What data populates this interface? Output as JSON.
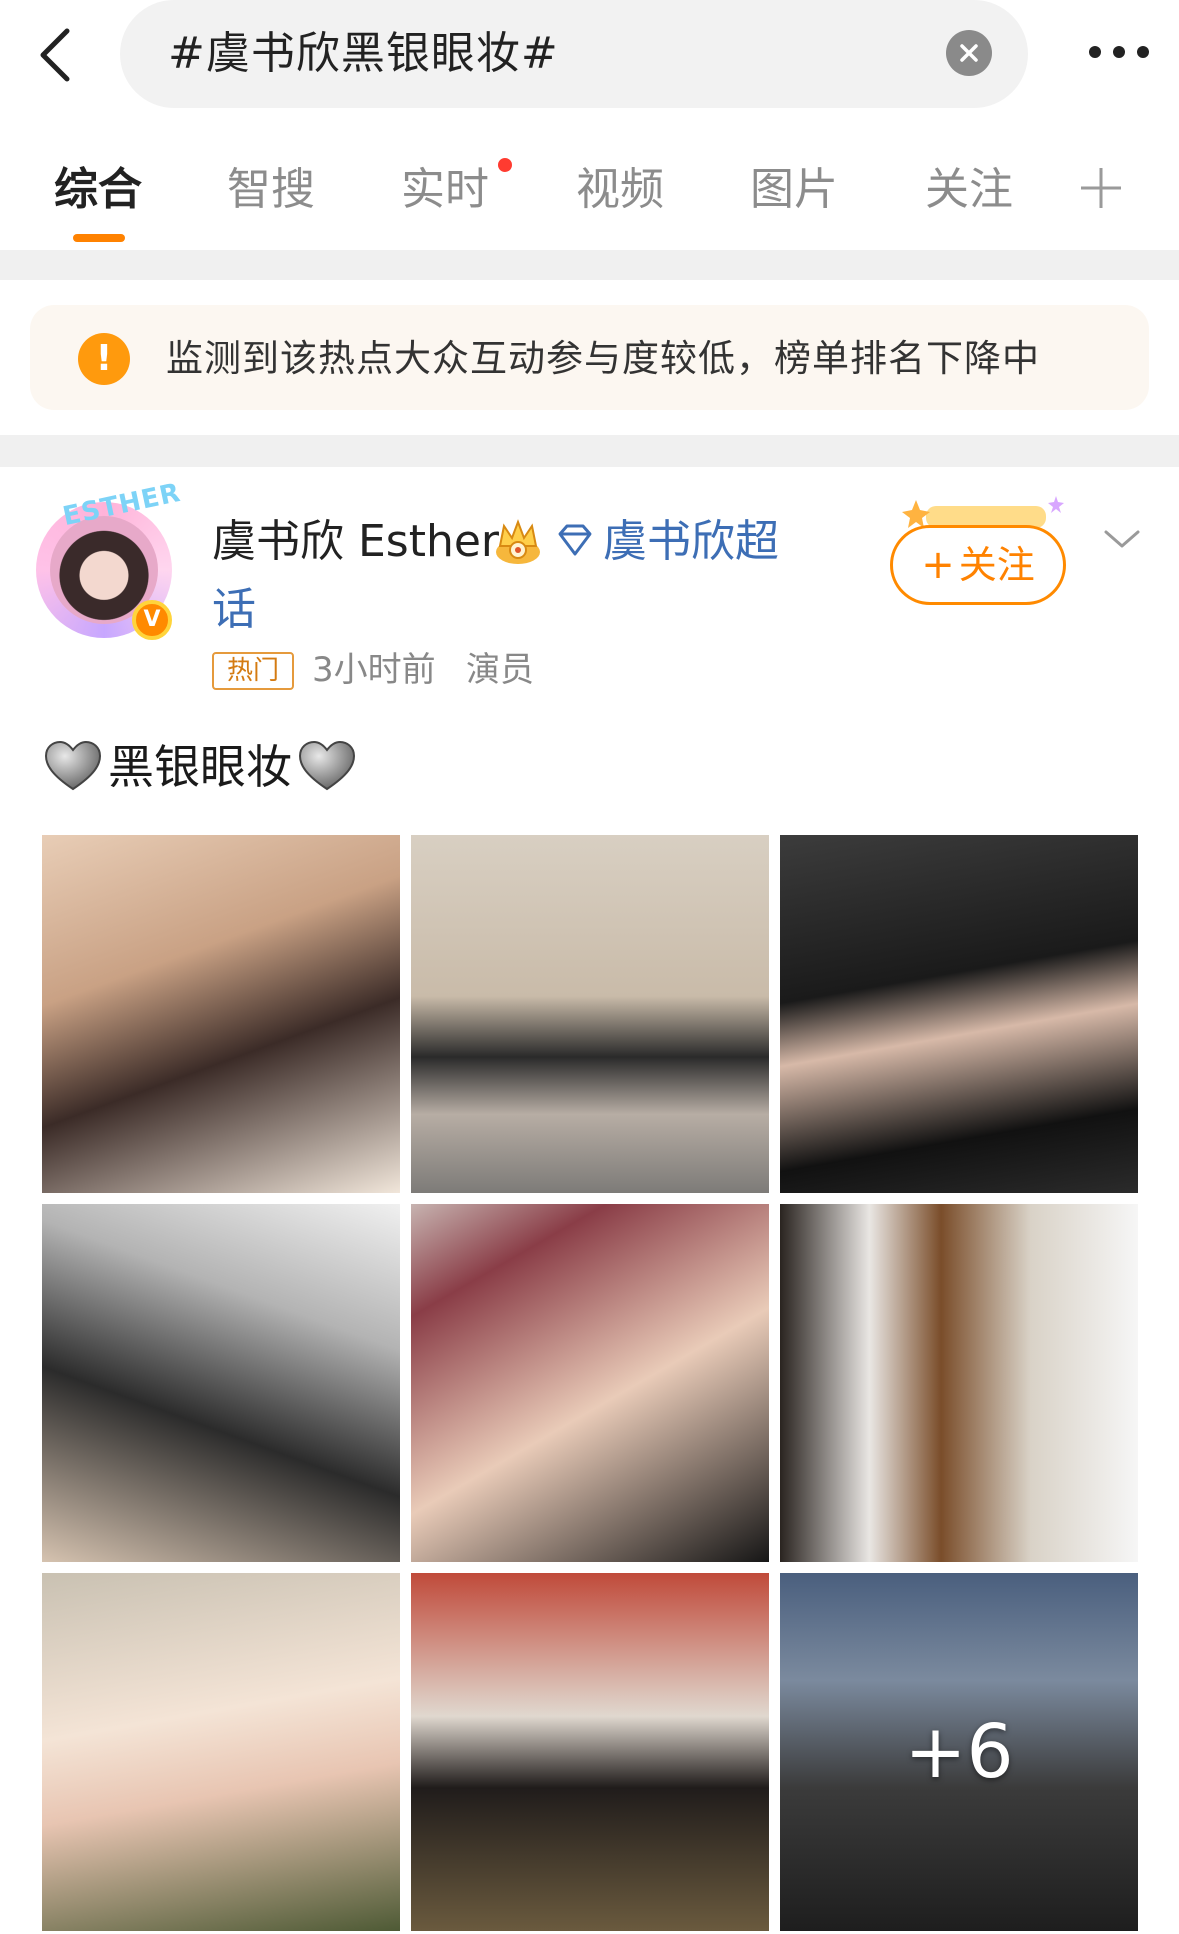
{
  "search": {
    "query": "#虞书欣黑银眼妆#"
  },
  "tabs": [
    {
      "label": "综合",
      "active": true
    },
    {
      "label": "智搜"
    },
    {
      "label": "实时",
      "has_dot": true
    },
    {
      "label": "视频"
    },
    {
      "label": "图片"
    },
    {
      "label": "关注"
    }
  ],
  "notice": {
    "icon": "!",
    "text": "监测到该热点大众互动参与度较低，榜单排名下降中"
  },
  "post": {
    "avatar": {
      "arc_text": "ESTHER",
      "badge": "V"
    },
    "author": "虞书欣 Esther",
    "supertopic_line1": "虞书欣超",
    "supertopic_line2": "话",
    "hot_tag": "热门",
    "time": "3小时前",
    "role": "演员",
    "follow_label": "关注",
    "follow_plus": "+",
    "text": "黑银眼妆",
    "more_count": "+6"
  },
  "colors": {
    "accent": "#ff8200",
    "link": "#3d6eb5",
    "notice_bg": "#fcf7f1"
  },
  "icons": [
    "back-arrow-icon",
    "clear-icon",
    "more-icon",
    "plus-icon",
    "warning-icon",
    "crown-icon",
    "diamond-icon",
    "chevron-down-icon",
    "silver-heart-icon"
  ]
}
